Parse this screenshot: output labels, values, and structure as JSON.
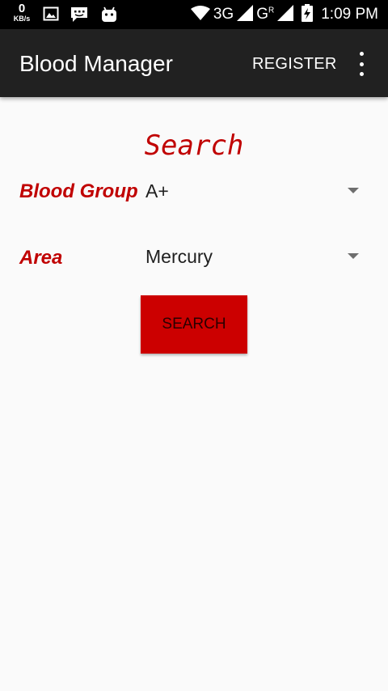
{
  "status_bar": {
    "speed_value": "0",
    "speed_unit": "KB/s",
    "network_1": "3G",
    "network_2": "G",
    "network_2_sup": "R",
    "time": "1:09 PM",
    "icons": [
      "image-icon",
      "chat-icon",
      "android-icon",
      "wifi-icon",
      "signal-icon",
      "signal-icon",
      "battery-charging-icon"
    ]
  },
  "toolbar": {
    "title": "Blood Manager",
    "register_label": "REGISTER",
    "overflow_icon": "more-vert-icon"
  },
  "form": {
    "heading": "Search",
    "blood_group_label": "Blood Group",
    "blood_group_value": "A+",
    "area_label": "Area",
    "area_value": "Mercury",
    "search_button_label": "SEARCH"
  },
  "colors": {
    "accent": "#c00000",
    "button": "#cc0000",
    "toolbar": "#212121",
    "background": "#fafafa"
  }
}
